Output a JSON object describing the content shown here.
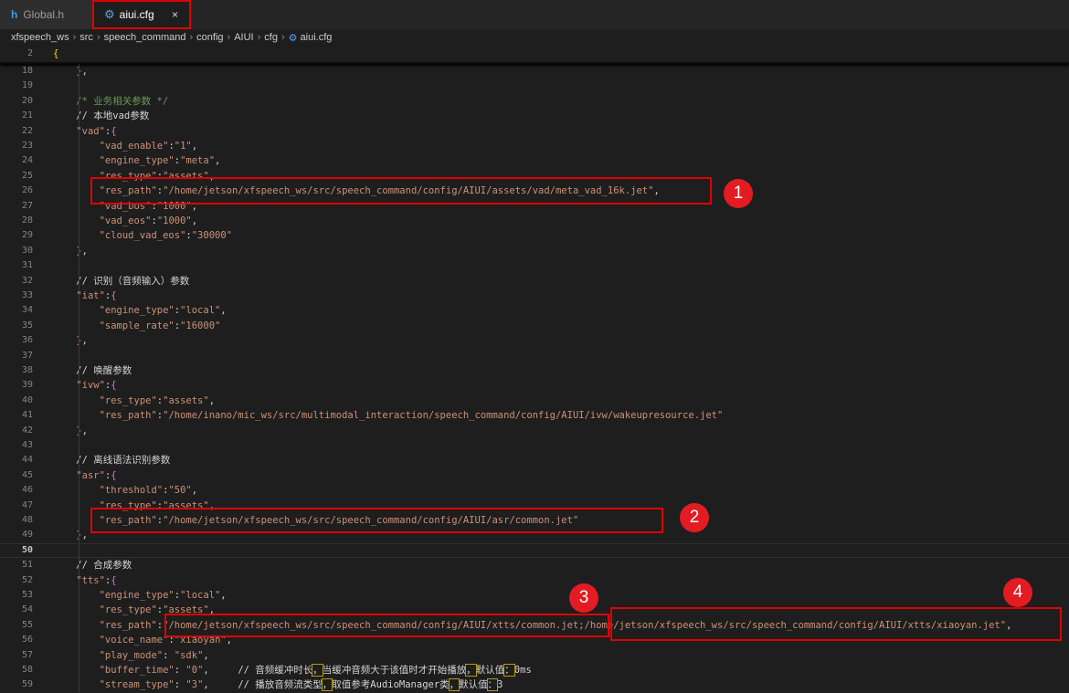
{
  "tabs": [
    {
      "icon": "h",
      "label": "Global.h"
    },
    {
      "icon": "gear",
      "label": "aiui.cfg",
      "close": "×"
    }
  ],
  "breadcrumb": [
    "xfspeech_ws",
    "src",
    "speech_command",
    "config",
    "AIUI",
    "cfg",
    "aiui.cfg"
  ],
  "sticky": {
    "ln": "2",
    "code": "{"
  },
  "lines": [
    {
      "ln": "18",
      "code": "    },"
    },
    {
      "ln": "19",
      "code": ""
    },
    {
      "ln": "20",
      "code": "    /* 业务相关参数 */"
    },
    {
      "ln": "21",
      "code": "    // 本地vad参数"
    },
    {
      "ln": "22",
      "code": "    \"vad\":{"
    },
    {
      "ln": "23",
      "code": "        \"vad_enable\":\"1\","
    },
    {
      "ln": "24",
      "code": "        \"engine_type\":\"meta\","
    },
    {
      "ln": "25",
      "code": "        \"res_type\":\"assets\","
    },
    {
      "ln": "26",
      "code": "        \"res_path\":\"/home/jetson/xfspeech_ws/src/speech_command/config/AIUI/assets/vad/meta_vad_16k.jet\","
    },
    {
      "ln": "27",
      "code": "        \"vad_bos\":\"1000\","
    },
    {
      "ln": "28",
      "code": "        \"vad_eos\":\"1000\","
    },
    {
      "ln": "29",
      "code": "        \"cloud_vad_eos\":\"30000\""
    },
    {
      "ln": "30",
      "code": "    },"
    },
    {
      "ln": "31",
      "code": ""
    },
    {
      "ln": "32",
      "code": "    // 识别（音频输入）参数"
    },
    {
      "ln": "33",
      "code": "    \"iat\":{"
    },
    {
      "ln": "34",
      "code": "        \"engine_type\":\"local\","
    },
    {
      "ln": "35",
      "code": "        \"sample_rate\":\"16000\""
    },
    {
      "ln": "36",
      "code": "    },"
    },
    {
      "ln": "37",
      "code": ""
    },
    {
      "ln": "38",
      "code": "    // 唤醒参数"
    },
    {
      "ln": "39",
      "code": "    \"ivw\":{"
    },
    {
      "ln": "40",
      "code": "        \"res_type\":\"assets\","
    },
    {
      "ln": "41",
      "code": "        \"res_path\":\"/home/inano/mic_ws/src/multimodal_interaction/speech_command/config/AIUI/ivw/wakeupresource.jet\""
    },
    {
      "ln": "42",
      "code": "    },"
    },
    {
      "ln": "43",
      "code": ""
    },
    {
      "ln": "44",
      "code": "    // 离线语法识别参数"
    },
    {
      "ln": "45",
      "code": "    \"asr\":{"
    },
    {
      "ln": "46",
      "code": "        \"threshold\":\"50\","
    },
    {
      "ln": "47",
      "code": "        \"res_type\":\"assets\","
    },
    {
      "ln": "48",
      "code": "        \"res_path\":\"/home/jetson/xfspeech_ws/src/speech_command/config/AIUI/asr/common.jet\""
    },
    {
      "ln": "49",
      "code": "    },"
    },
    {
      "ln": "50",
      "code": ""
    },
    {
      "ln": "51",
      "code": "    // 合成参数"
    },
    {
      "ln": "52",
      "code": "    \"tts\":{"
    },
    {
      "ln": "53",
      "code": "        \"engine_type\":\"local\","
    },
    {
      "ln": "54",
      "code": "        \"res_type\":\"assets\","
    },
    {
      "ln": "55",
      "code": "        \"res_path\":\"/home/jetson/xfspeech_ws/src/speech_command/config/AIUI/xtts/common.jet;/home/jetson/xfspeech_ws/src/speech_command/config/AIUI/xtts/xiaoyan.jet\","
    },
    {
      "ln": "56",
      "code": "        \"voice_name\":\"xiaoyan\","
    },
    {
      "ln": "57",
      "code": "        \"play_mode\": \"sdk\","
    },
    {
      "ln": "58",
      "code": "        \"buffer_time\": \"0\",     // 音频缓冲时长，当缓冲音频大于该值时才开始播放，默认值：0ms"
    },
    {
      "ln": "59",
      "code": "        \"stream_type\": \"3\",     // 播放音频流类型，取值参考AudioManager类，默认值：3"
    }
  ],
  "current_line": "50",
  "annotations": [
    "1",
    "2",
    "3",
    "4"
  ]
}
